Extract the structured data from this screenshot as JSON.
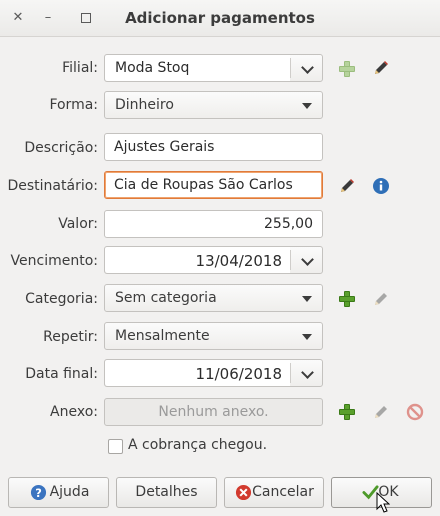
{
  "window": {
    "title": "Adicionar pagamentos"
  },
  "form": {
    "filial": {
      "label": "Filial:",
      "value": "Moda Stoq"
    },
    "forma": {
      "label": "Forma:",
      "value": "Dinheiro"
    },
    "descricao": {
      "label": "Descrição:",
      "value": "Ajustes Gerais"
    },
    "destinatario": {
      "label": "Destinatário:",
      "value": "Cia de Roupas São Carlos"
    },
    "valor": {
      "label": "Valor:",
      "value": "255,00"
    },
    "vencimento": {
      "label": "Vencimento:",
      "value": "13/04/2018"
    },
    "categoria": {
      "label": "Categoria:",
      "value": "Sem categoria"
    },
    "repetir": {
      "label": "Repetir:",
      "value": "Mensalmente"
    },
    "data_final": {
      "label": "Data final:",
      "value": "11/06/2018"
    },
    "anexo": {
      "label": "Anexo:",
      "value": "Nenhum anexo."
    },
    "cobranca": {
      "label": "A cobrança chegou.",
      "checked": false
    }
  },
  "buttons": {
    "ajuda": "Ajuda",
    "detalhes": "Detalhes",
    "cancelar": "Cancelar",
    "ok": "OK"
  },
  "icons": {
    "add": "plus-icon",
    "edit": "pencil-icon",
    "info": "info-icon",
    "remove": "no-entry-icon",
    "help": "help-icon",
    "cancel": "cancel-icon",
    "ok": "check-icon"
  },
  "colors": {
    "focus_border": "#e07a3a",
    "add_green": "#5aa02c",
    "info_blue": "#2f6fb7"
  }
}
